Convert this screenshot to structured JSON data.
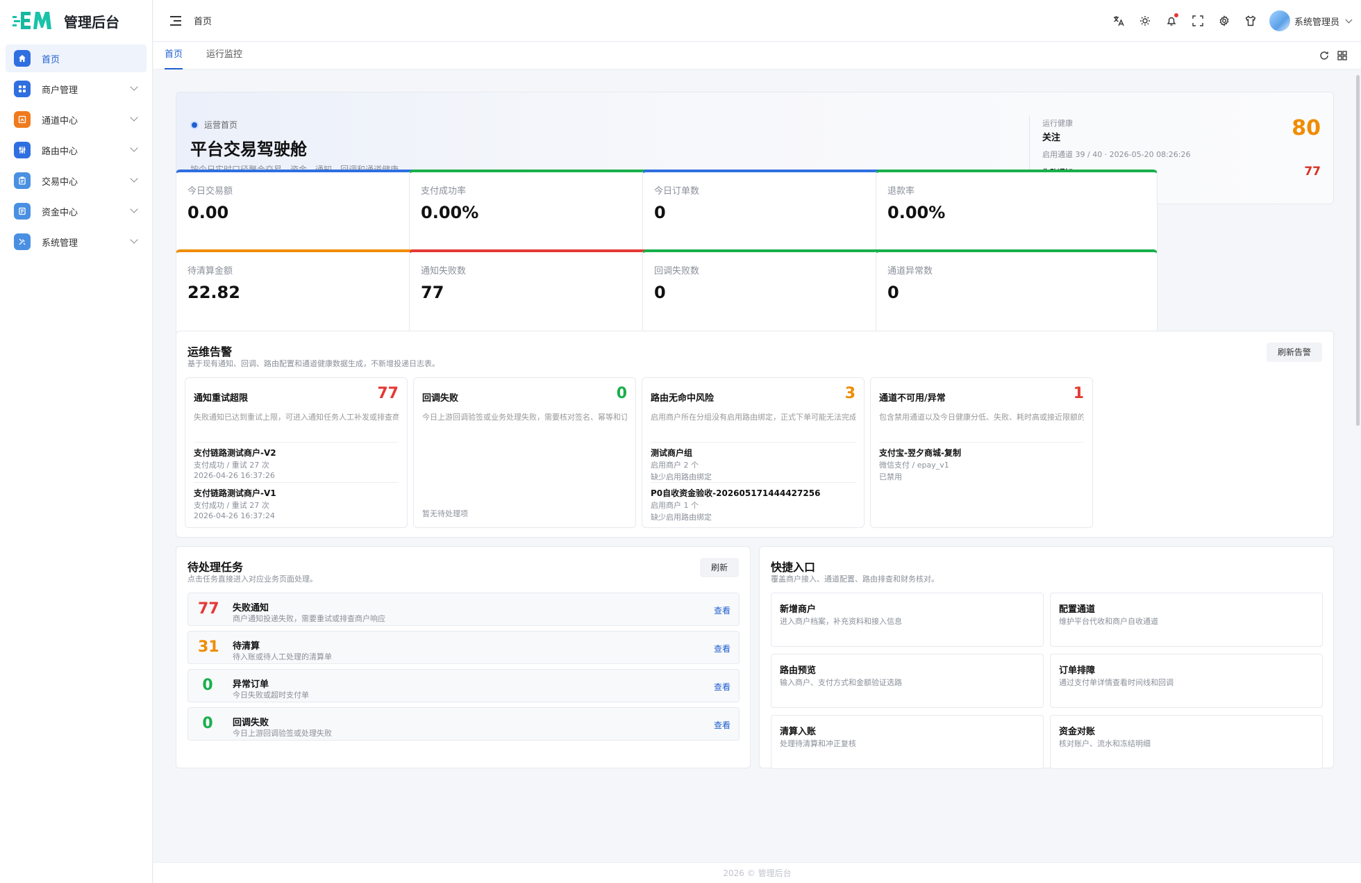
{
  "app": {
    "title": "管理后台"
  },
  "sidebar": {
    "items": [
      {
        "label": "首页",
        "icon": "home-icon",
        "color": "#2f6fe0"
      },
      {
        "label": "商户管理",
        "icon": "apps-icon",
        "color": "#2f6fe0"
      },
      {
        "label": "通道中心",
        "icon": "channel-icon",
        "color": "#f07a1e"
      },
      {
        "label": "路由中心",
        "icon": "route-icon",
        "color": "#2f6fe0"
      },
      {
        "label": "交易中心",
        "icon": "clipboard-icon",
        "color": "#4a90e2"
      },
      {
        "label": "资金中心",
        "icon": "finance-icon",
        "color": "#4a90e2"
      },
      {
        "label": "系统管理",
        "icon": "tools-icon",
        "color": "#4a90e2"
      }
    ]
  },
  "header": {
    "breadcrumb": "首页",
    "user": "系统管理员"
  },
  "tabs": [
    {
      "label": "首页"
    },
    {
      "label": "运行监控"
    }
  ],
  "hero": {
    "tag": "运营首页",
    "title": "平台交易驾驶舱",
    "subtitle": "按今日实时口径聚合交易、资金、通知、回调和通道健康。",
    "health_label": "运行健康",
    "health_state": "关注",
    "health_score": "80",
    "health_meta": "启用通道 39 / 40 · 2026-05-20 08:26:26",
    "fail_label": "失败通知",
    "fail_count": "77"
  },
  "stats": [
    {
      "label": "今日交易额",
      "value": "0.00",
      "color": "#2f6fe0"
    },
    {
      "label": "支付成功率",
      "value": "0.00%",
      "color": "#18b04c"
    },
    {
      "label": "今日订单数",
      "value": "0",
      "color": "#2f6fe0"
    },
    {
      "label": "退款率",
      "value": "0.00%",
      "color": "#18b04c"
    },
    {
      "label": "待清算金额",
      "value": "22.82",
      "color": "#f08c00"
    },
    {
      "label": "通知失败数",
      "value": "77",
      "color": "#e53935"
    },
    {
      "label": "回调失败数",
      "value": "0",
      "color": "#18b04c"
    },
    {
      "label": "通道异常数",
      "value": "0",
      "color": "#18b04c"
    }
  ],
  "alerts": {
    "title": "运维告警",
    "subtitle": "基于现有通知、回调、路由配置和通道健康数据生成，不新增投递日志表。",
    "refresh": "刷新告警",
    "cards": [
      {
        "title": "通知重试超限",
        "count": "77",
        "color": "#e53935",
        "desc": "失败通知已达到重试上限，可进入通知任务人工补发或排查商户响应",
        "items": [
          {
            "name": "支付链路测试商户-V2",
            "l1": "支付成功 / 重试 27 次",
            "l2": "2026-04-26 16:37:26"
          },
          {
            "name": "支付链路测试商户-V1",
            "l1": "支付成功 / 重试 27 次",
            "l2": "2026-04-26 16:37:24"
          }
        ]
      },
      {
        "title": "回调失败",
        "count": "0",
        "color": "#18b04c",
        "desc": "今日上游回调验签或业务处理失败，需要核对签名、幂等和订单状态",
        "empty": "暂无待处理项"
      },
      {
        "title": "路由无命中风险",
        "count": "3",
        "color": "#f08c00",
        "desc": "启用商户所在分组没有启用路由绑定，正式下单可能无法完成选路",
        "items": [
          {
            "name": "测试商户组",
            "l1": "启用商户 2 个",
            "l2": "缺少启用路由绑定"
          },
          {
            "name": "P0自收资金验收-202605171444427256",
            "l1": "启用商户 1 个",
            "l2": "缺少启用路由绑定"
          }
        ]
      },
      {
        "title": "通道不可用/异常",
        "count": "1",
        "color": "#e53935",
        "desc": "包含禁用通道以及今日健康分低、失败、耗时高或接近限额的通道",
        "items": [
          {
            "name": "支付宝-翌夕商城-复制",
            "l1": "微信支付 / epay_v1",
            "l2": "已禁用"
          }
        ]
      }
    ]
  },
  "tasks": {
    "title": "待处理任务",
    "subtitle": "点击任务直接进入对应业务页面处理。",
    "refresh": "刷新",
    "link": "查看",
    "items": [
      {
        "num": "77",
        "title": "失败通知",
        "desc": "商户通知投递失败，需要重试或排查商户响应",
        "color": "#e53935"
      },
      {
        "num": "31",
        "title": "待清算",
        "desc": "待入账或待人工处理的清算单",
        "color": "#f08c00"
      },
      {
        "num": "0",
        "title": "异常订单",
        "desc": "今日失败或超时支付单",
        "color": "#18b04c"
      },
      {
        "num": "0",
        "title": "回调失败",
        "desc": "今日上游回调验签或处理失败",
        "color": "#18b04c"
      }
    ]
  },
  "quick": {
    "title": "快捷入口",
    "subtitle": "覆盖商户接入、通道配置、路由排查和财务核对。",
    "items": [
      {
        "title": "新增商户",
        "desc": "进入商户档案，补充资料和接入信息"
      },
      {
        "title": "配置通道",
        "desc": "维护平台代收和商户自收通道"
      },
      {
        "title": "路由预览",
        "desc": "输入商户、支付方式和金额验证选路"
      },
      {
        "title": "订单排障",
        "desc": "通过支付单详情查看时间线和回调"
      },
      {
        "title": "清算入账",
        "desc": "处理待清算和冲正复核"
      },
      {
        "title": "资金对账",
        "desc": "核对账户、流水和冻结明细"
      }
    ]
  },
  "footer": {
    "text": "2026 © 管理后台"
  }
}
